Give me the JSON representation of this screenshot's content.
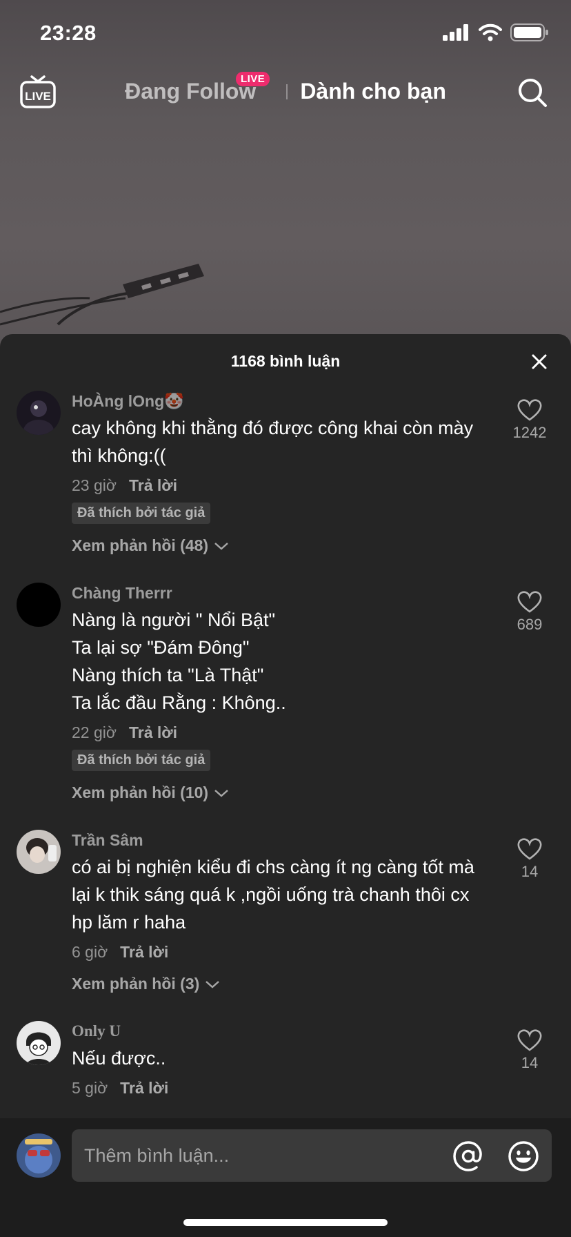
{
  "status_bar": {
    "time": "23:28"
  },
  "top_nav": {
    "live_label": "LIVE",
    "tab_following": "Đang Follow",
    "live_badge": "LIVE",
    "tab_for_you": "Dành cho bạn"
  },
  "comments_sheet": {
    "title": "1168 bình luận",
    "liked_by_author_label": "Đã thích bởi tác giả",
    "reply_label": "Trả lời",
    "comments": [
      {
        "username": "HoÀng lOng🤡",
        "text": "cay không khi thằng đó được công khai còn mày thì không:((",
        "time": "23 giờ",
        "reply": "Trả lời",
        "liked_by_author": "Đã thích bởi tác giả",
        "view_replies": "Xem phản hồi (48)",
        "likes": "1242"
      },
      {
        "username": "Chàng Therrr",
        "text_lines": [
          "Nàng là người \" Nổi Bật\"",
          "Ta lại sợ \"Đám Đông\"",
          "Nàng thích ta \"Là Thật\"",
          "Ta lắc đầu Rằng : Không.."
        ],
        "time": "22 giờ",
        "reply": "Trả lời",
        "liked_by_author": "Đã thích bởi tác giả",
        "view_replies": "Xem phản hồi (10)",
        "likes": "689"
      },
      {
        "username": "Trần Sâm",
        "text": "có ai bị nghiện kiểu đi chs càng ít ng càng tốt mà lại k thik sáng quá k ,ngồi uống trà chanh thôi cx hp lăm r haha",
        "time": "6 giờ",
        "reply": "Trả lời",
        "view_replies": "Xem phản hồi (3)",
        "likes": "14"
      },
      {
        "username": "Only U",
        "text": "Nếu được..",
        "time": "5 giờ",
        "reply": "Trả lời",
        "likes": "14"
      }
    ]
  },
  "input_bar": {
    "placeholder": "Thêm bình luận..."
  },
  "icons": [
    "live-icon",
    "search-icon",
    "close-icon",
    "heart-icon",
    "chevron-down-icon",
    "at-icon",
    "emoji-icon",
    "signal-icon",
    "wifi-icon",
    "battery-icon"
  ],
  "colors": {
    "sheet_bg": "#252525",
    "live_badge": "#ee2c6d",
    "input_bg": "#3a3a3a"
  }
}
